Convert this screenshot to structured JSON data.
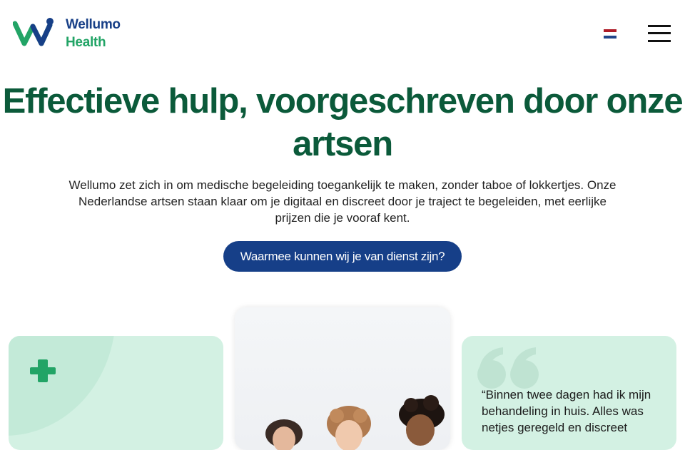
{
  "header": {
    "brand_line1": "Wellumo",
    "brand_line2": "Health",
    "logo_icon": "wellumo-w-logo",
    "language_icon": "netherlands-flag-icon",
    "menu_icon": "hamburger-menu-icon"
  },
  "hero": {
    "title": "Effectieve hulp, voorgeschreven door onze artsen",
    "description": "Wellumo zet zich in om medische begeleiding toegankelijk te maken, zonder taboe of lokkertjes. Onze Nederlandse artsen staan klaar om je digitaal en discreet door je traject te begeleiden, met eerlijke prijzen die je vooraf kent.",
    "cta_label": "Waarmee kunnen wij je van dienst zijn?"
  },
  "cards": {
    "left_icon": "medical-plus-icon",
    "center_image": "team-photo",
    "right_icon": "quote-icon",
    "testimonial": "“Binnen twee dagen had ik mijn behandeling in huis. Alles was netjes geregeld en discreet"
  },
  "colors": {
    "brand_navy": "#173f87",
    "brand_green": "#22a466",
    "title_green": "#0b5a3a",
    "card_mint": "#d3f1e3",
    "cta_blue": "#163f88"
  }
}
